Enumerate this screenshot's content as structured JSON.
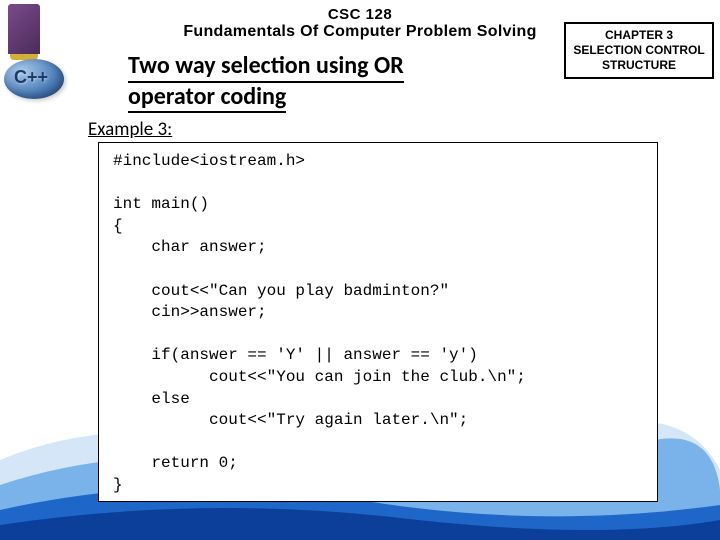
{
  "header": {
    "course_code": "CSC 128",
    "course_title": "Fundamentals Of Computer Problem Solving"
  },
  "chapter": {
    "line1": "CHAPTER 3",
    "line2": "SELECTION CONTROL",
    "line3": "STRUCTURE"
  },
  "topic": {
    "line1": "Two way selection using OR",
    "line2": "operator coding"
  },
  "example_label": "Example 3:",
  "cpp_label": "C++",
  "code": "#include<iostream.h>\n\nint main()\n{\n    char answer;\n\n    cout<<\"Can you play badminton?\"\n    cin>>answer;\n\n    if(answer == 'Y' || answer == 'y')\n          cout<<\"You can join the club.\\n\";\n    else\n          cout<<\"Try again later.\\n\";\n\n    return 0;\n}"
}
